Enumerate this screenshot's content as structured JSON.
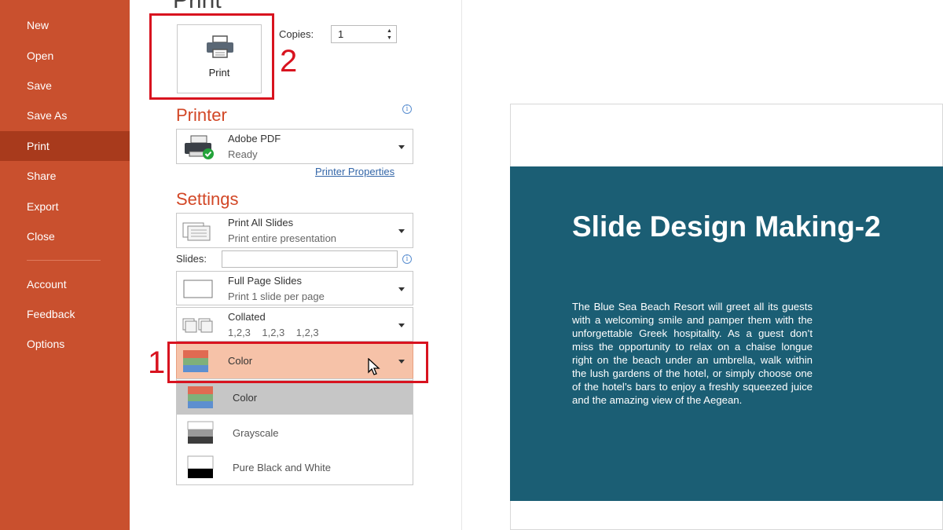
{
  "sidebar": {
    "items": [
      {
        "label": "New"
      },
      {
        "label": "Open"
      },
      {
        "label": "Save"
      },
      {
        "label": "Save As"
      },
      {
        "label": "Print",
        "active": true
      },
      {
        "label": "Share"
      },
      {
        "label": "Export"
      },
      {
        "label": "Close"
      },
      {
        "label": "Account"
      },
      {
        "label": "Feedback"
      },
      {
        "label": "Options"
      }
    ],
    "color": "#c9502e",
    "active_color": "#a83a1c"
  },
  "panel": {
    "title": "Print",
    "print_button_label": "Print",
    "copies_label": "Copies:",
    "copies_value": "1"
  },
  "printer": {
    "heading": "Printer",
    "name": "Adobe PDF",
    "status": "Ready",
    "properties_link": "Printer Properties"
  },
  "settings": {
    "heading": "Settings",
    "range": {
      "title": "Print All Slides",
      "subtitle": "Print entire presentation"
    },
    "slides_label": "Slides:",
    "slides_value": "",
    "layout": {
      "title": "Full Page Slides",
      "subtitle": "Print 1 slide per page"
    },
    "collation": {
      "title": "Collated",
      "subtitle": "1,2,3    1,2,3    1,2,3"
    },
    "color_mode": {
      "selected": "Color",
      "options": [
        "Color",
        "Grayscale",
        "Pure Black and White"
      ]
    }
  },
  "annotations": {
    "callout_1": "1",
    "callout_2": "2",
    "highlight_color": "#d8131f"
  },
  "preview": {
    "slide_title": "Slide Design Making-2",
    "slide_body": "The Blue Sea Beach Resort will greet all its guests with a welcoming smile and pamper them with the unforgettable Greek hospitality. As a guest don’t miss the opportunity to relax on a chaise longue right on the beach under an umbrella, walk within the lush gardens of the hotel, or simply choose one of the hotel’s bars to enjoy a freshly squeezed juice and the amazing view of the Aegean.",
    "slide_color": "#1b5e74"
  }
}
